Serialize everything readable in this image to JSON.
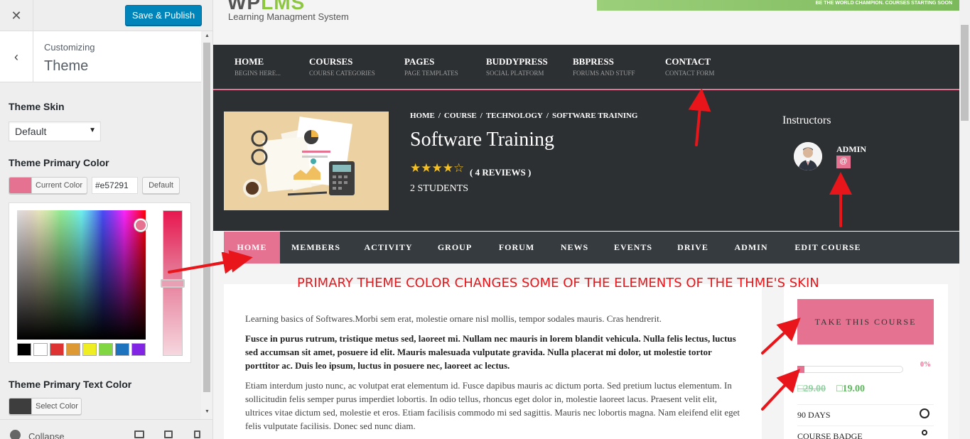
{
  "customizer": {
    "publish_label": "Save & Publish",
    "breadcrumb_label": "Customizing",
    "section_title": "Theme",
    "theme_skin_label": "Theme Skin",
    "theme_skin_value": "Default",
    "primary_color_label": "Theme Primary Color",
    "current_color_label": "Current Color",
    "hex_value": "#e57291",
    "default_label": "Default",
    "palette": [
      "#000000",
      "#ffffff",
      "#dd3333",
      "#dd9933",
      "#eeee22",
      "#81d742",
      "#1e73be",
      "#8224e3"
    ],
    "primary_text_color_label": "Theme Primary Text Color",
    "select_color_label": "Select Color",
    "collapse_label": "Collapse"
  },
  "site": {
    "logo_text_a": "WP",
    "logo_text_b": "LMS",
    "tagline": "Learning Managment System",
    "banner_text": "BE THE WORLD CHAMPION. COURSES STARTING SOON",
    "nav": [
      {
        "title": "HOME",
        "sub": "BEGINS HERE..."
      },
      {
        "title": "COURSES",
        "sub": "COURSE CATEGORIES"
      },
      {
        "title": "PAGES",
        "sub": "PAGE TEMPLATES"
      },
      {
        "title": "BUDDYPRESS",
        "sub": "SOCIAL PLATFORM"
      },
      {
        "title": "BBPRESS",
        "sub": "FORUMS AND STUFF"
      },
      {
        "title": "CONTACT",
        "sub": "CONTACT FORM"
      }
    ]
  },
  "course": {
    "breadcrumb": [
      "HOME",
      "COURSE",
      "TECHNOLOGY",
      "SOFTWARE TRAINING"
    ],
    "breadcrumb_sep": "/",
    "title": "Software Training",
    "stars": "★★★★☆",
    "rating": 4,
    "reviews_text": "( 4 REVIEWS )",
    "students_text": "2 STUDENTS",
    "instructors_title": "Instructors",
    "instructor_name": "ADMIN",
    "instructor_email_icon": "@",
    "tabs": [
      "HOME",
      "MEMBERS",
      "ACTIVITY",
      "GROUP",
      "FORUM",
      "NEWS",
      "EVENTS",
      "DRIVE",
      "ADMIN",
      "EDIT COURSE"
    ],
    "active_tab": "HOME",
    "paragraphs": [
      "Learning basics of Softwares.Morbi sem erat, molestie ornare nisl mollis, tempor sodales mauris. Cras hendrerit.",
      "Fusce in purus rutrum, tristique metus sed, laoreet mi. Nullam nec mauris in lorem blandit vehicula. Nulla felis lectus, luctus sed accumsan sit amet, posuere id elit. Mauris malesuada vulputate gravida. Nulla placerat mi dolor, ut molestie tortor porttitor ac. Duis leo ipsum, luctus in posuere nec, laoreet ac lectus.",
      "Etiam interdum justo nunc, ac volutpat erat elementum id. Fusce dapibus mauris ac dictum porta. Sed pretium luctus elementum. In sollicitudin felis semper purus imperdiet lobortis. In odio tellus, rhoncus eget dolor in, molestie laoreet lacus. Praesent velit elit, ultrices vitae dictum sed, molestie et eros. Etiam facilisis commodo mi sed sagittis. Mauris nec lobortis magna. Nam eleifend elit eget felis vulputate facilisis. Donec sed nunc diam."
    ],
    "take_course_label": "TAKE THIS COURSE",
    "progress_text": "0%",
    "progress_value": 0,
    "price_old": "29.00",
    "price_new": "19.00",
    "currency_glyph": "□",
    "duration": "90 DAYS",
    "badge_label": "COURSE BADGE"
  },
  "annotation": "PRIMARY THEME COLOR CHANGES SOME OF THE ELEMENTS OF THE THME'S SKIN",
  "colors": {
    "primary": "#e57291",
    "dark_bg": "#2d3033",
    "publish_blue": "#0085ba",
    "arrow_red": "#e8161a"
  }
}
